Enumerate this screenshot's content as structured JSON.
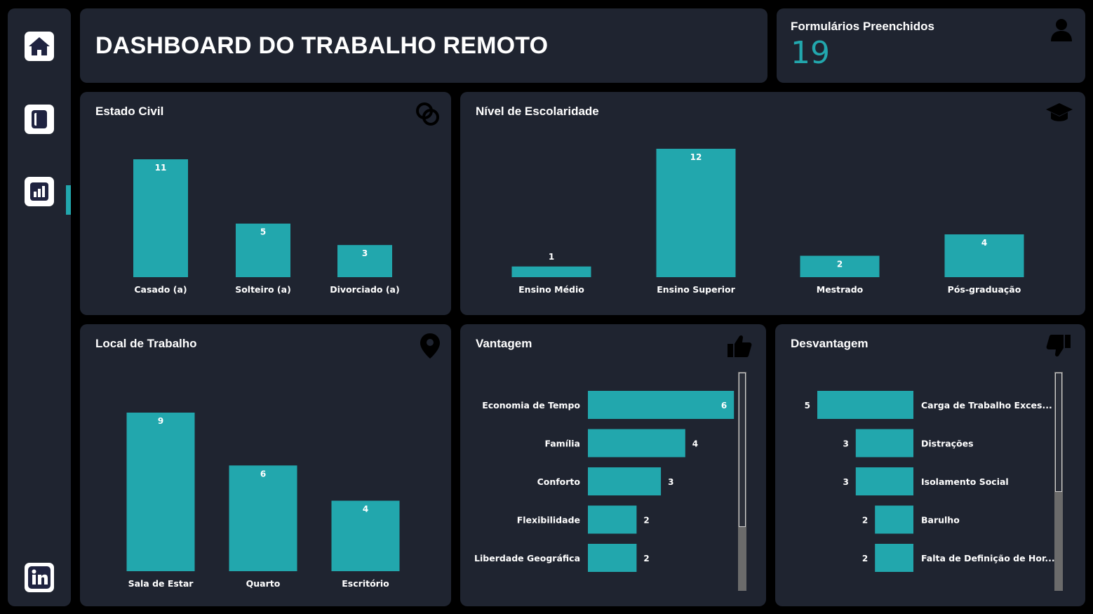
{
  "header": {
    "title": "DASHBOARD DO TRABALHO REMOTO"
  },
  "kpi": {
    "label": "Formulários Preenchidos",
    "value": "19"
  },
  "sidebar": {
    "items": [
      {
        "name": "home-icon"
      },
      {
        "name": "book-icon"
      },
      {
        "name": "bar-chart-icon",
        "active": true
      },
      {
        "name": "linkedin-icon"
      }
    ]
  },
  "colors": {
    "accent": "#22a7ad",
    "panel": "#1f2430",
    "background": "#000000",
    "text": "#ffffff"
  },
  "panels": {
    "estado_civil": {
      "title": "Estado Civil",
      "icon": "rings-icon"
    },
    "escolaridade": {
      "title": "Nível de Escolaridade",
      "icon": "graduation-cap-icon"
    },
    "local": {
      "title": "Local de Trabalho",
      "icon": "map-pin-icon"
    },
    "vantagem": {
      "title": "Vantagem",
      "icon": "thumbs-up-icon"
    },
    "desvantagem": {
      "title": "Desvantagem",
      "icon": "thumbs-down-icon"
    }
  },
  "chart_data": [
    {
      "id": "estado_civil",
      "type": "bar",
      "categories": [
        "Casado (a)",
        "Solteiro (a)",
        "Divorciado (a)"
      ],
      "values": [
        11,
        5,
        3
      ]
    },
    {
      "id": "escolaridade",
      "type": "bar",
      "categories": [
        "Ensino Médio",
        "Ensino Superior",
        "Mestrado",
        "Pós-graduação"
      ],
      "values": [
        1,
        12,
        2,
        4
      ]
    },
    {
      "id": "local",
      "type": "bar",
      "categories": [
        "Sala de Estar",
        "Quarto",
        "Escritório"
      ],
      "values": [
        9,
        6,
        4
      ]
    },
    {
      "id": "vantagem",
      "type": "bar",
      "orientation": "horizontal",
      "categories": [
        "Economia de Tempo",
        "Família",
        "Conforto",
        "Flexibilidade",
        "Liberdade Geográfica"
      ],
      "values": [
        6,
        4,
        3,
        2,
        2
      ]
    },
    {
      "id": "desvantagem",
      "type": "bar",
      "orientation": "horizontal-reversed",
      "categories": [
        "Carga de Trabalho Exces...",
        "Distrações",
        "Isolamento Social",
        "Barulho",
        "Falta de Definição de Hor..."
      ],
      "values": [
        5,
        3,
        3,
        2,
        2
      ]
    }
  ]
}
